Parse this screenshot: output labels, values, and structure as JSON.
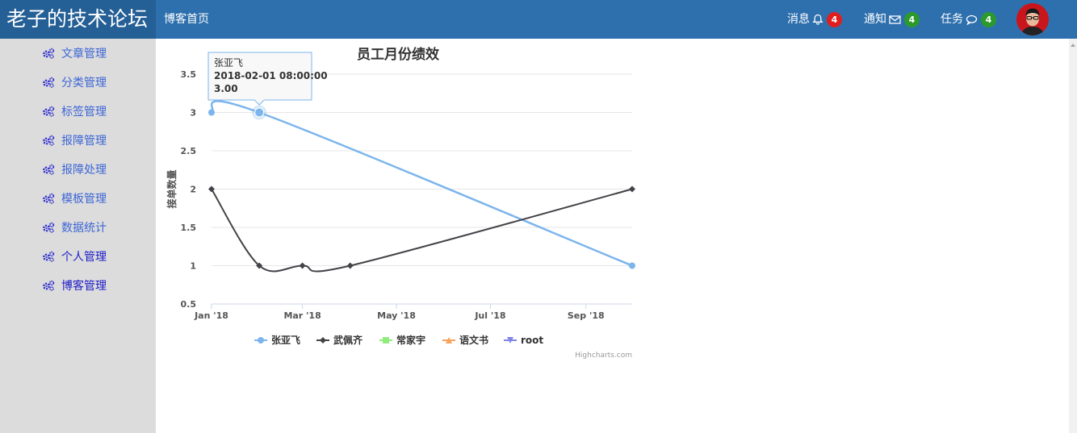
{
  "header": {
    "brand": "老子的技术论坛",
    "home_link": "博客首页",
    "messages": {
      "label": "消息",
      "count": "4",
      "badge_color": "#e11e1e"
    },
    "notices": {
      "label": "通知",
      "count": "4",
      "badge_color": "#2b9a2b"
    },
    "tasks": {
      "label": "任务",
      "count": "4",
      "badge_color": "#2b9a2b"
    }
  },
  "sidebar": {
    "items": [
      {
        "label": "文章管理"
      },
      {
        "label": "分类管理"
      },
      {
        "label": "标签管理"
      },
      {
        "label": "报障管理"
      },
      {
        "label": "报障处理"
      },
      {
        "label": "模板管理"
      },
      {
        "label": "数据统计"
      },
      {
        "label": "个人管理"
      },
      {
        "label": "博客管理"
      }
    ]
  },
  "chart_data": {
    "type": "line",
    "title": "员工月份绩效",
    "ylabel": "接单数量",
    "xlabel": "",
    "ylim": [
      0.5,
      3.5
    ],
    "yticks": [
      "0.5",
      "1",
      "1.5",
      "2",
      "2.5",
      "3",
      "3.5"
    ],
    "xticks": [
      {
        "label": "Jan '18",
        "date": "2018-01-01"
      },
      {
        "label": "Mar '18",
        "date": "2018-03-01"
      },
      {
        "label": "May '18",
        "date": "2018-05-01"
      },
      {
        "label": "Jul '18",
        "date": "2018-07-01"
      },
      {
        "label": "Sep '18",
        "date": "2018-09-01"
      }
    ],
    "grid": true,
    "legend_position": "bottom-center",
    "series": [
      {
        "name": "张亚飞",
        "color": "#7cb5ec",
        "marker": "circle",
        "points": [
          {
            "x": "2018-01-01",
            "y": 3
          },
          {
            "x": "2018-02-01",
            "y": 3
          },
          {
            "x": "2018-10-01",
            "y": 1
          }
        ]
      },
      {
        "name": "武佩齐",
        "color": "#434348",
        "marker": "diamond",
        "points": [
          {
            "x": "2018-01-01",
            "y": 2
          },
          {
            "x": "2018-02-01",
            "y": 1
          },
          {
            "x": "2018-03-01",
            "y": 1
          },
          {
            "x": "2018-04-01",
            "y": 1
          },
          {
            "x": "2018-10-01",
            "y": 2
          }
        ]
      },
      {
        "name": "常家宇",
        "color": "#90ed7d",
        "marker": "square",
        "points": []
      },
      {
        "name": "语文书",
        "color": "#f7a35c",
        "marker": "triangle",
        "points": []
      },
      {
        "name": "root",
        "color": "#8085e9",
        "marker": "triangle-down",
        "points": []
      }
    ],
    "tooltip": {
      "series": "张亚飞",
      "date": "2018-02-01 08:00:00",
      "value": "3.00"
    },
    "credits": "Highcharts.com"
  }
}
